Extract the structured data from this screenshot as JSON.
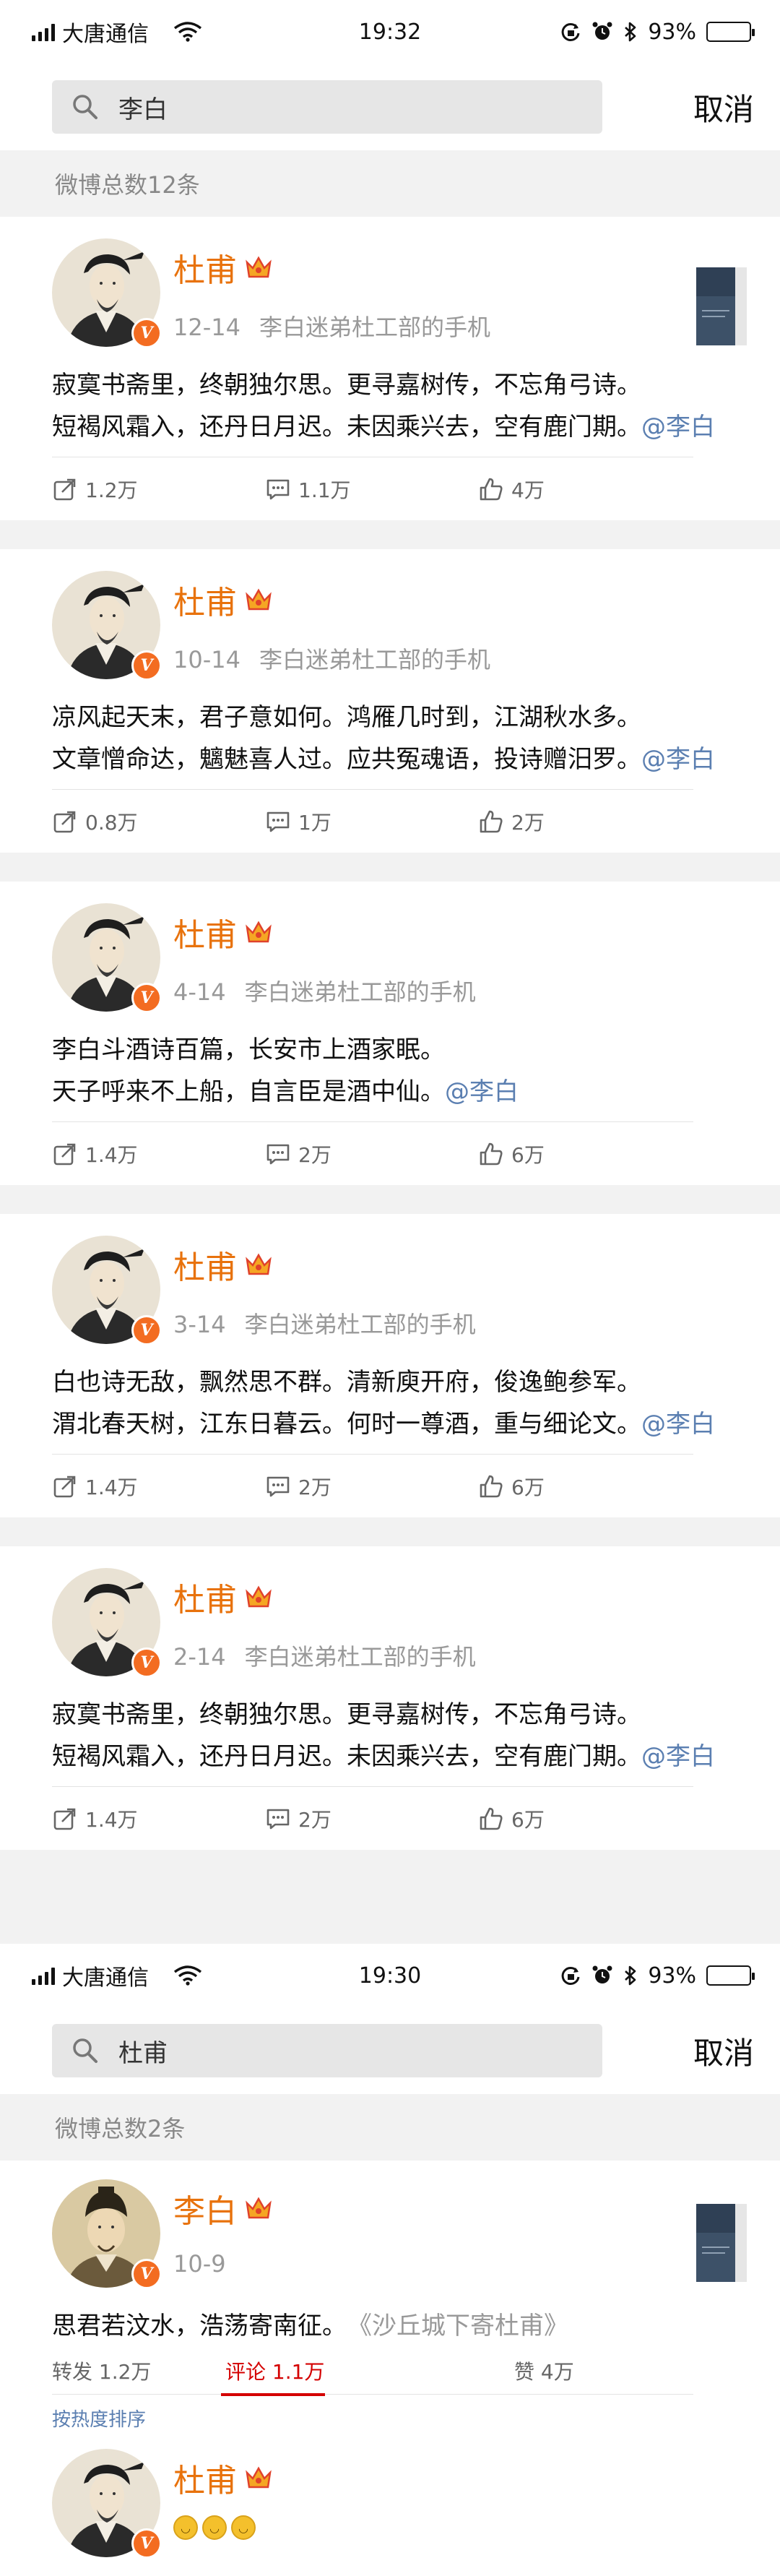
{
  "screen1": {
    "status": {
      "carrier": "大唐通信",
      "time": "19:32",
      "battery": "93%",
      "battery_level": 0.93
    },
    "search": {
      "query": "李白",
      "cancel_label": "取消"
    },
    "count_label": "微博总数12条",
    "posts": [
      {
        "author": "杜甫",
        "date": "12-14",
        "source": "李白迷弟杜工部的手机",
        "line1": "寂寞书斋里，终朝独尔思。更寻嘉树传，不忘角弓诗。",
        "line2": "短褐风霜入，还丹日月迟。未因乘兴去，空有鹿门期。",
        "mention": "@李白",
        "reposts": "1.2万",
        "comments": "1.1万",
        "likes": "4万",
        "has_thumb": true
      },
      {
        "author": "杜甫",
        "date": "10-14",
        "source": "李白迷弟杜工部的手机",
        "line1": "凉风起天末，君子意如何。鸿雁几时到，江湖秋水多。",
        "line2": "文章憎命达，魑魅喜人过。应共冤魂语，投诗赠汨罗。",
        "mention": "@李白",
        "reposts": "0.8万",
        "comments": "1万",
        "likes": "2万",
        "has_thumb": false
      },
      {
        "author": "杜甫",
        "date": "4-14",
        "source": "李白迷弟杜工部的手机",
        "line1": "李白斗酒诗百篇，长安市上酒家眠。",
        "line2": "天子呼来不上船，自言臣是酒中仙。",
        "mention": "@李白",
        "reposts": "1.4万",
        "comments": "2万",
        "likes": "6万",
        "has_thumb": false
      },
      {
        "author": "杜甫",
        "date": "3-14",
        "source": "李白迷弟杜工部的手机",
        "line1": "白也诗无敌，飘然思不群。清新庾开府，俊逸鲍参军。",
        "line2": "渭北春天树，江东日暮云。何时一尊酒，重与细论文。",
        "mention": "@李白",
        "reposts": "1.4万",
        "comments": "2万",
        "likes": "6万",
        "has_thumb": false
      },
      {
        "author": "杜甫",
        "date": "2-14",
        "source": "李白迷弟杜工部的手机",
        "line1": "寂寞书斋里，终朝独尔思。更寻嘉树传，不忘角弓诗。",
        "line2": "短褐风霜入，还丹日月迟。未因乘兴去，空有鹿门期。",
        "mention": "@李白",
        "reposts": "1.4万",
        "comments": "2万",
        "likes": "6万",
        "has_thumb": false
      }
    ]
  },
  "screen2": {
    "status": {
      "carrier": "大唐通信",
      "time": "19:30",
      "battery": "93%",
      "battery_level": 0.93
    },
    "search": {
      "query": "杜甫",
      "cancel_label": "取消"
    },
    "count_label": "微博总数2条",
    "post": {
      "author": "李白",
      "date": "10-9",
      "text": "思君若汶水，浩荡寄南征。",
      "title": "《沙丘城下寄杜甫》",
      "tab_repost": "转发 1.2万",
      "tab_comment": "评论 1.1万",
      "tab_like": "赞 4万"
    },
    "sort_label": "按热度排序",
    "comment": {
      "author": "杜甫"
    }
  },
  "colors": {
    "name_orange": "#e8720c",
    "mention_blue": "#5b7fb1",
    "active_red": "#d40000",
    "gray_bg": "#f2f2f2"
  }
}
